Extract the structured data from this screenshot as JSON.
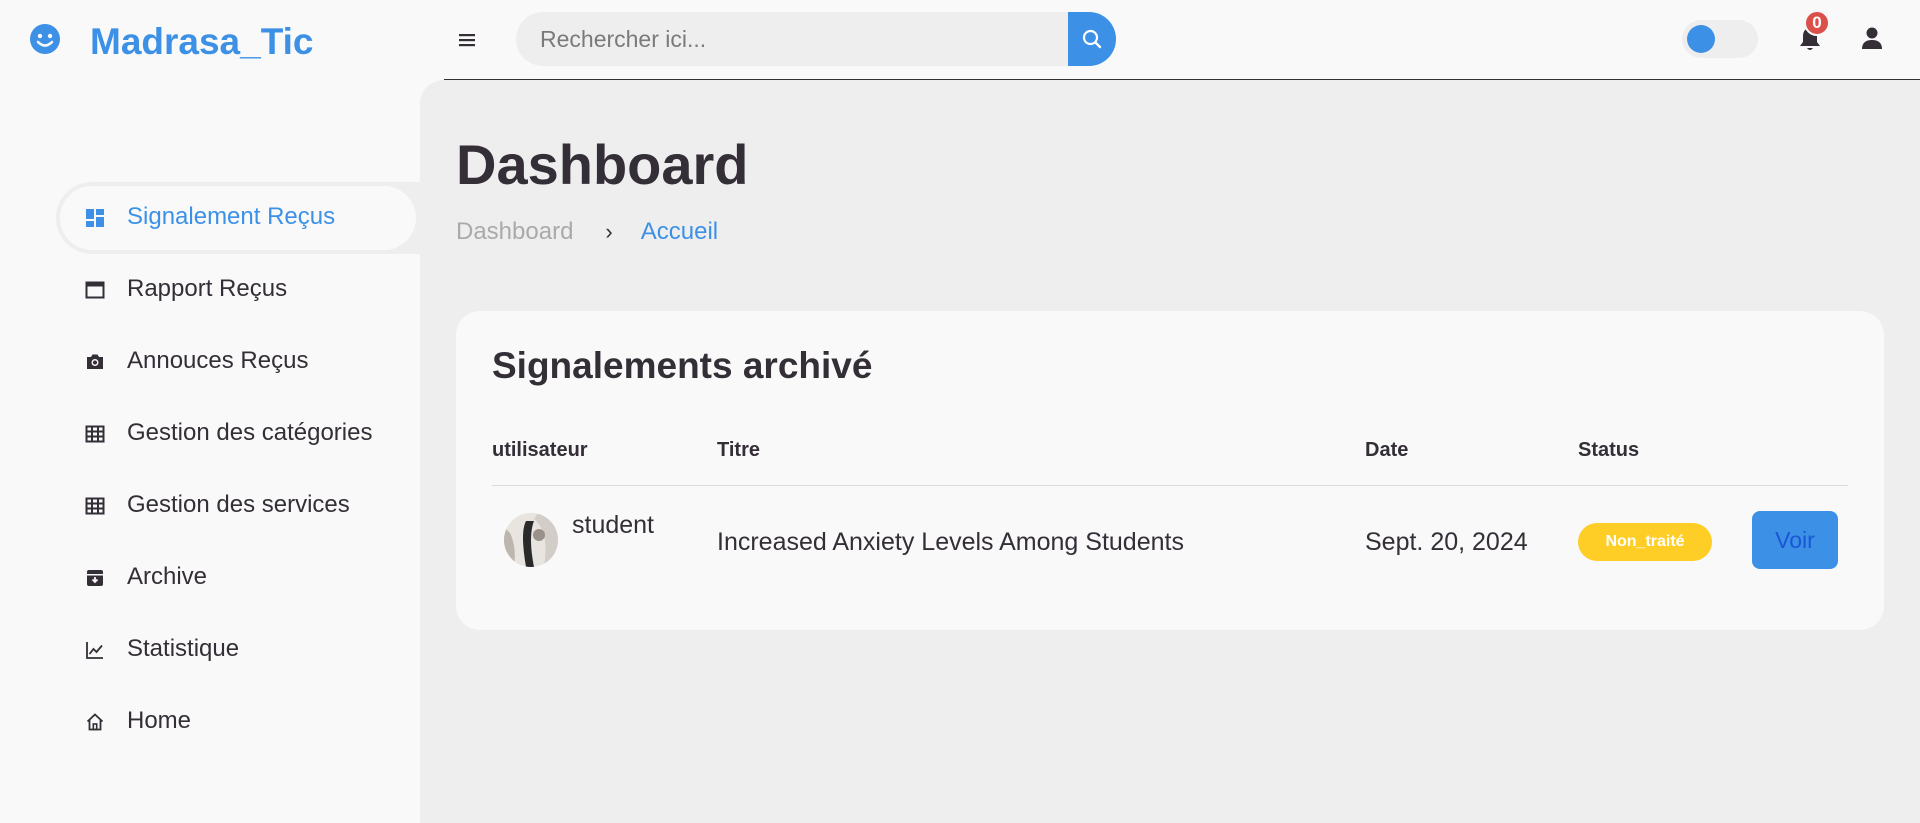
{
  "brand": {
    "name": "Madrasa_Tic",
    "icon": "smile-icon"
  },
  "search": {
    "placeholder": "Rechercher ici..."
  },
  "notifications": {
    "count": "0"
  },
  "colors": {
    "primary": "#3c91e6",
    "warning": "#ffce26",
    "danger": "#db504a",
    "text": "#342e37"
  },
  "sidebar": {
    "items": [
      {
        "label": "Signalement Reçus",
        "icon": "dashboard-icon",
        "active": true
      },
      {
        "label": "Rapport Reçus",
        "icon": "window-icon"
      },
      {
        "label": "Annouces Reçus",
        "icon": "camera-icon"
      },
      {
        "label": "Gestion des catégories",
        "icon": "table-icon"
      },
      {
        "label": "Gestion des services",
        "icon": "table-icon"
      },
      {
        "label": "Archive",
        "icon": "archive-icon"
      },
      {
        "label": "Statistique",
        "icon": "line-chart-icon"
      },
      {
        "label": "Home",
        "icon": "home-icon"
      }
    ]
  },
  "page": {
    "title": "Dashboard",
    "breadcrumb": [
      "Dashboard",
      "Accueil"
    ]
  },
  "table": {
    "title": "Signalements archivé",
    "headers": [
      "utilisateur",
      "Titre",
      "Date",
      "Status"
    ],
    "rows": [
      {
        "user": "student",
        "title": "Increased Anxiety Levels Among Students",
        "date": "Sept. 20, 2024",
        "status": "Non_traité",
        "action": "Voir"
      }
    ]
  }
}
